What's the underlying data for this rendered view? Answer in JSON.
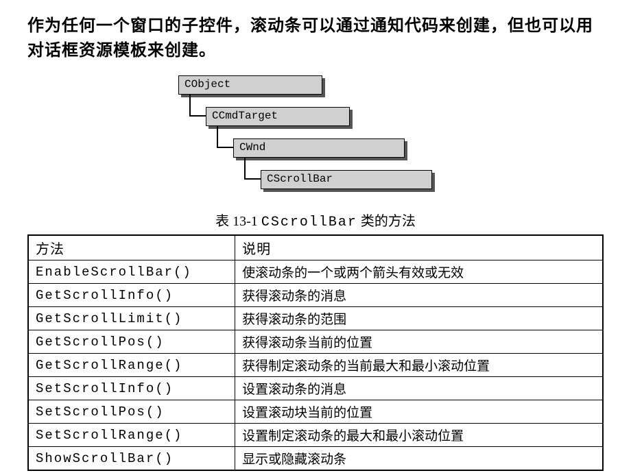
{
  "intro": "作为任何一个窗口的子控件，滚动条可以通过通知代码来创建，但也可以用对话框资源模板来创建。",
  "hierarchy": [
    "CObject",
    "CCmdTarget",
    "CWnd",
    "CScrollBar"
  ],
  "caption_prefix": "表 13-1 ",
  "caption_mono": "CScrollBar",
  "caption_suffix": " 类的方法",
  "table": {
    "headers": {
      "method": "方法",
      "desc": "说明"
    },
    "rows": [
      {
        "method": "EnableScrollBar()",
        "desc": "使滚动条的一个或两个箭头有效或无效"
      },
      {
        "method": "GetScrollInfo()",
        "desc": "获得滚动条的消息"
      },
      {
        "method": "GetScrollLimit()",
        "desc": "获得滚动条的范围"
      },
      {
        "method": "GetScrollPos()",
        "desc": "获得滚动条当前的位置"
      },
      {
        "method": "GetScrollRange()",
        "desc": "获得制定滚动条的当前最大和最小滚动位置"
      },
      {
        "method": "SetScrollInfo()",
        "desc": "设置滚动条的消息"
      },
      {
        "method": "SetScrollPos()",
        "desc": "设置滚动块当前的位置"
      },
      {
        "method": "SetScrollRange()",
        "desc": "设置制定滚动条的最大和最小滚动位置"
      },
      {
        "method": "ShowScrollBar()",
        "desc": "显示或隐藏滚动条"
      }
    ]
  }
}
